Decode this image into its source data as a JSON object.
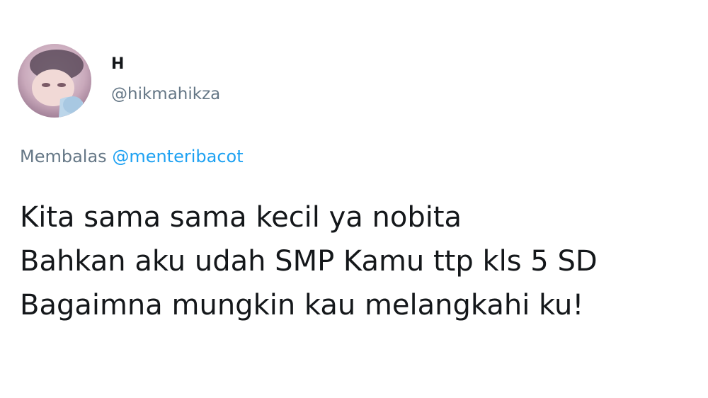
{
  "user": {
    "display_name": "H",
    "handle": "@hikmahikza"
  },
  "reply": {
    "prefix": "Membalas",
    "mention": "@menteribacot"
  },
  "tweet": {
    "lines": [
      "Kita sama sama kecil ya nobita",
      "Bahkan aku udah SMP Kamu ttp kls 5 SD",
      "Bagaimna mungkin kau melangkahi ku!"
    ]
  },
  "colors": {
    "text": "#14171a",
    "secondary": "#657786",
    "link": "#1da1f2",
    "background": "#ffffff"
  },
  "icons": {
    "avatar": "profile-photo"
  }
}
